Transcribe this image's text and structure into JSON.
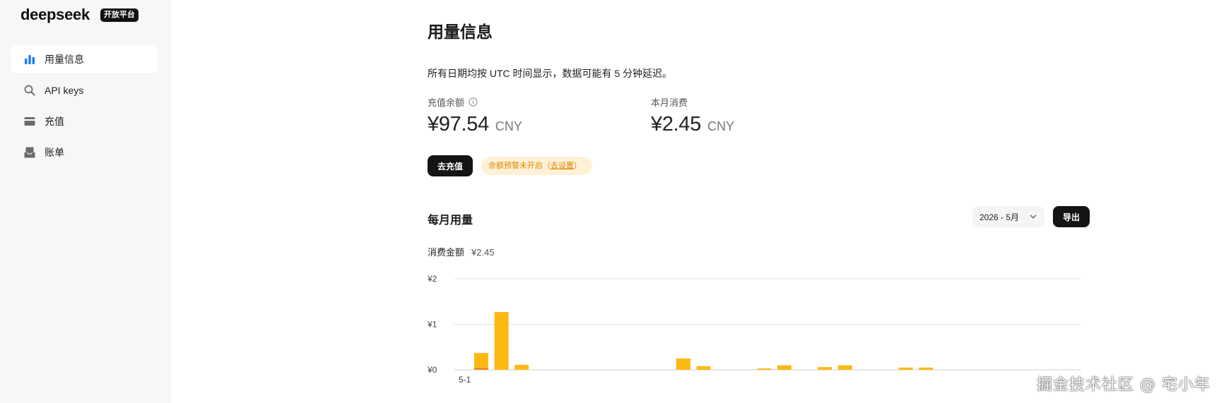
{
  "brand": {
    "name": "deepseek",
    "badge": "开放平台"
  },
  "sidebar": {
    "items": [
      {
        "label": "用量信息",
        "icon": "bar-chart-icon",
        "active": true
      },
      {
        "label": "API keys",
        "icon": "search-icon",
        "active": false
      },
      {
        "label": "充值",
        "icon": "wallet-icon",
        "active": false
      },
      {
        "label": "账单",
        "icon": "inbox-icon",
        "active": false
      }
    ]
  },
  "page": {
    "title": "用量信息",
    "notice": "所有日期均按 UTC 时间显示，数据可能有 5 分钟延迟。"
  },
  "balance": {
    "label": "充值余额",
    "amount": "¥97.54",
    "unit": "CNY"
  },
  "monthly_spend": {
    "label": "本月消费",
    "amount": "¥2.45",
    "unit": "CNY"
  },
  "actions": {
    "topup_label": "去充值",
    "alert_text": "余额预警未开启（",
    "alert_link": "去设置",
    "alert_close": "）"
  },
  "usage": {
    "title": "每月用量",
    "month": "2026 - 5月",
    "export_label": "导出",
    "total_label": "消费金额",
    "total_value": "¥2.45"
  },
  "colors": {
    "bar_main": "#fdb913",
    "bar_secondary": "#f08c1a",
    "accent": "#1677ff"
  },
  "chart_data": {
    "type": "bar",
    "stacked": true,
    "y_tick_labels": [
      "¥0",
      "¥1",
      "¥2"
    ],
    "ylim": [
      0,
      2
    ],
    "x_tick_labels": [
      "5-1"
    ],
    "days": 31,
    "series": [
      {
        "values": [
          0.05,
          0,
          0,
          0,
          0,
          0,
          0,
          0,
          0,
          0,
          0,
          0,
          0,
          0,
          0,
          0,
          0,
          0,
          0,
          0,
          0,
          0,
          0,
          0,
          0,
          0,
          0,
          0,
          0,
          0,
          0
        ]
      },
      {
        "values": [
          0.32,
          1.27,
          0.11,
          0,
          0,
          0,
          0,
          0,
          0,
          0,
          0.25,
          0.08,
          0,
          0,
          0.03,
          0.1,
          0,
          0.06,
          0.1,
          0,
          0,
          0.05,
          0.05,
          0,
          0,
          0,
          0,
          0,
          0,
          0,
          0
        ]
      }
    ]
  },
  "watermark": "掘金技术社区 @ 宅小年"
}
